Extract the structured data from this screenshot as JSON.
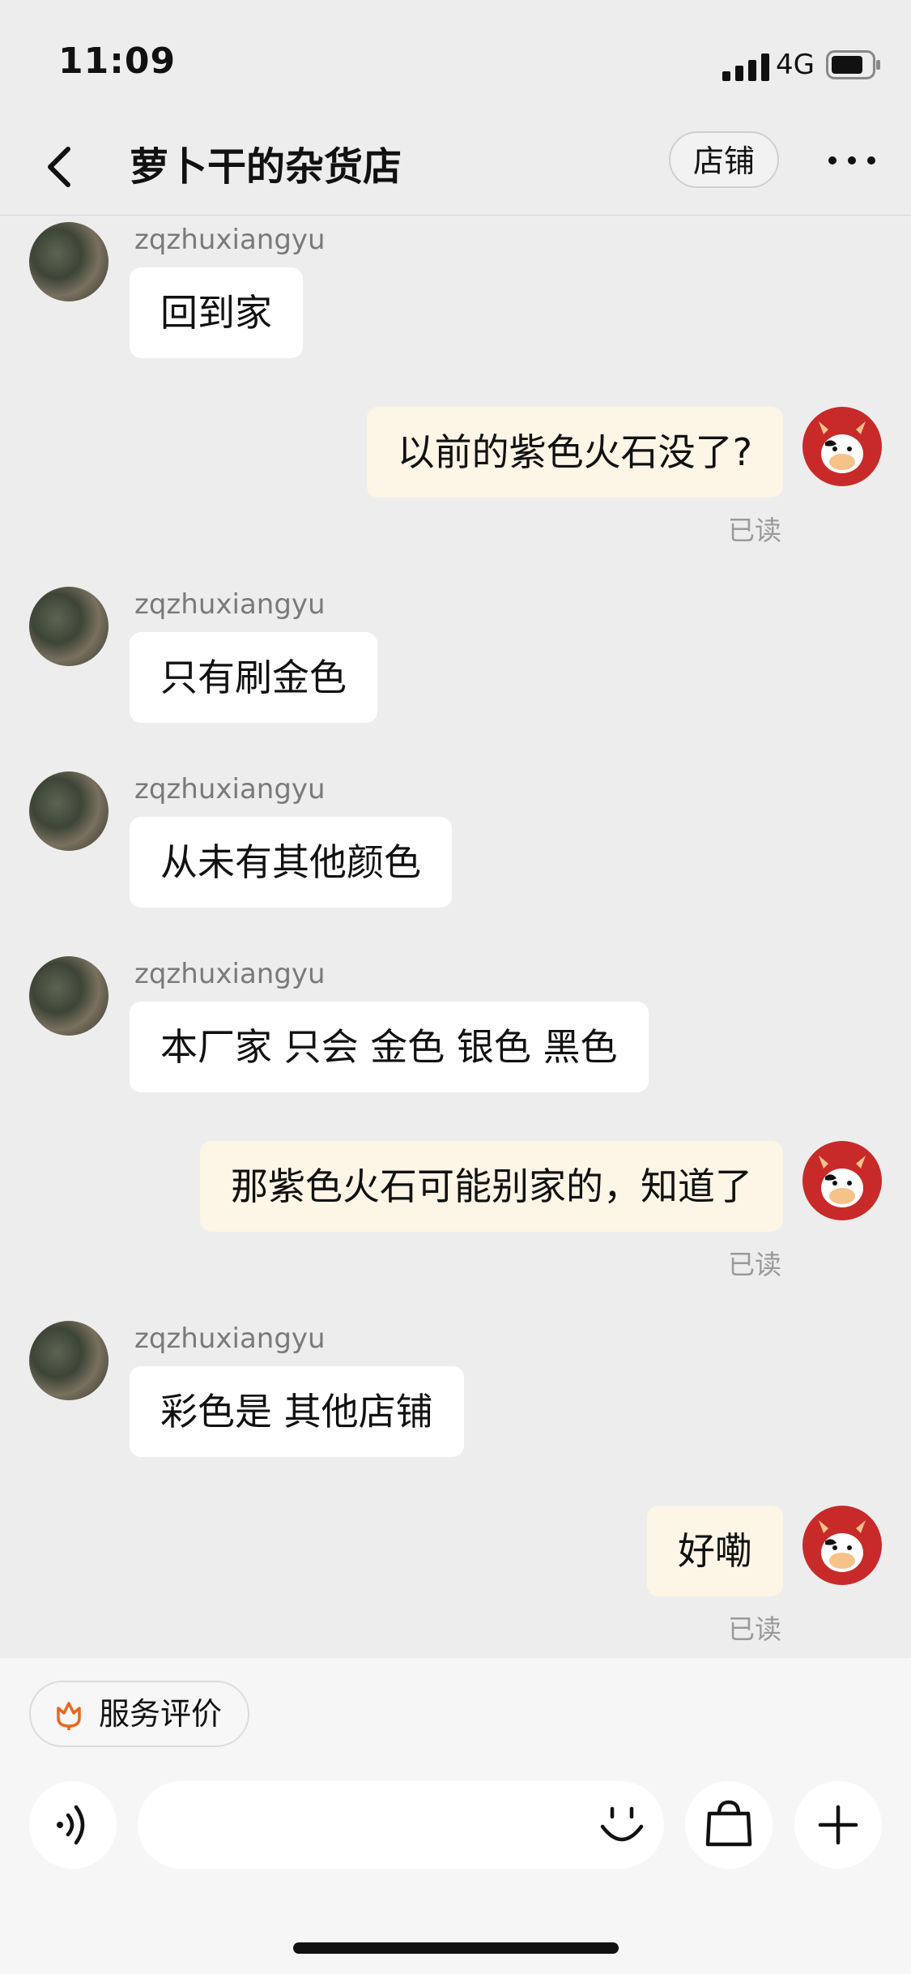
{
  "status": {
    "time": "11:09",
    "network": "4G"
  },
  "header": {
    "title": "萝卜干的杂货店",
    "shop_button": "店铺"
  },
  "messages": [
    {
      "sender": "zqzhuxiangyu",
      "text": "回到家"
    },
    {
      "text": "以前的紫色火石没了?",
      "status": "已读"
    },
    {
      "sender": "zqzhuxiangyu",
      "text": "只有刷金色"
    },
    {
      "sender": "zqzhuxiangyu",
      "text": "从未有其他颜色"
    },
    {
      "sender": "zqzhuxiangyu",
      "text": "本厂家 只会 金色 银色 黑色"
    },
    {
      "text": "那紫色火石可能别家的，知道了",
      "status": "已读"
    },
    {
      "sender": "zqzhuxiangyu",
      "text": "彩色是 其他店铺"
    },
    {
      "text": "好嘞",
      "status": "已读"
    }
  ],
  "bottom": {
    "rate_label": "服务评价"
  },
  "colors": {
    "accent": "#e8671c",
    "outgoing_bubble": "#fdf5e6",
    "avatar_red": "#c82a2a"
  }
}
